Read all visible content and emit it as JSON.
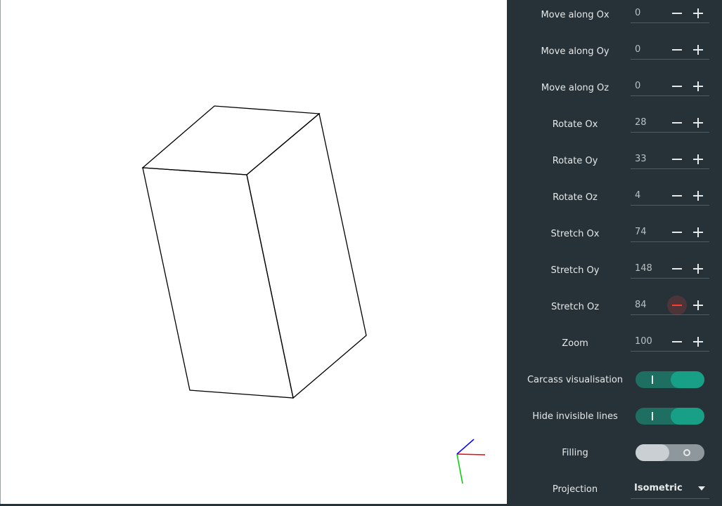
{
  "controls": {
    "move_ox": {
      "label": "Move along Ox",
      "value": "0"
    },
    "move_oy": {
      "label": "Move along Oy",
      "value": "0"
    },
    "move_oz": {
      "label": "Move along Oz",
      "value": "0"
    },
    "rotate_ox": {
      "label": "Rotate Ox",
      "value": "28"
    },
    "rotate_oy": {
      "label": "Rotate Oy",
      "value": "33"
    },
    "rotate_oz": {
      "label": "Rotate Oz",
      "value": "4"
    },
    "stretch_ox": {
      "label": "Stretch Ox",
      "value": "74"
    },
    "stretch_oy": {
      "label": "Stretch Oy",
      "value": "148"
    },
    "stretch_oz": {
      "label": "Stretch Oz",
      "value": "84"
    },
    "zoom": {
      "label": "Zoom",
      "value": "100"
    }
  },
  "toggles": {
    "carcass": {
      "label": "Carcass visualisation",
      "on": true
    },
    "hide_invisible": {
      "label": "Hide invisible lines",
      "on": true
    },
    "filling": {
      "label": "Filling",
      "on": false
    }
  },
  "projection": {
    "label": "Projection",
    "value": "Isometric"
  },
  "icons": {
    "minus": "minus-icon",
    "plus": "plus-icon",
    "dropdown": "chevron-down-icon"
  },
  "colors": {
    "panel_bg": "#263238",
    "accent": "#17a085",
    "active_minus": "#ff3b30",
    "axis_x": "#ff0000",
    "axis_y": "#00cc00",
    "axis_z": "#0000ff"
  }
}
